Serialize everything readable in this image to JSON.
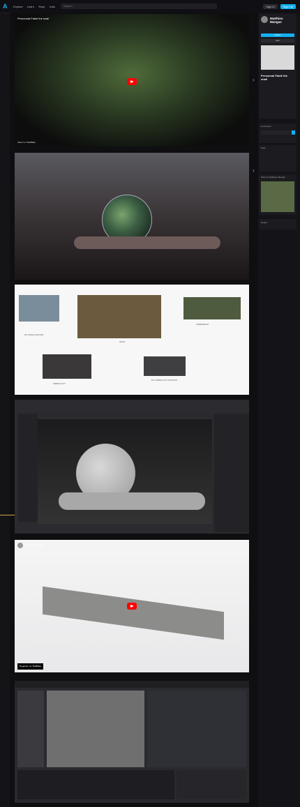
{
  "header": {
    "brand": "A",
    "nav": [
      "Explore",
      "Learn",
      "Shop",
      "Jobs"
    ],
    "search_placeholder": "Search",
    "actions": [
      "Sign In",
      "Sign Up"
    ]
  },
  "card1": {
    "title": "Personnal Fabié the snail",
    "watch_label": "Watch on",
    "yt_label": "YouTube"
  },
  "card3": {
    "labels": [
      "MY SNAIL PHOTOS",
      "SNAIL",
      "TERRARIUM",
      "URBAN CITY",
      "MY URBAN CITY PHOTOS"
    ]
  },
  "card5": {
    "channel": "sidewalk scan",
    "watch_label": "Regarder sur",
    "yt_label": "YouTube"
  },
  "sidebar": {
    "artist": "Matthieu Mangas",
    "follow_label": "Follow",
    "hire_label": "Hire",
    "project_title": "Personnal Fabié the snail",
    "comments_title": "Comments",
    "tags_title": "Tags",
    "more_title": "More by Matthieu Mangas",
    "report_title": "Report"
  }
}
